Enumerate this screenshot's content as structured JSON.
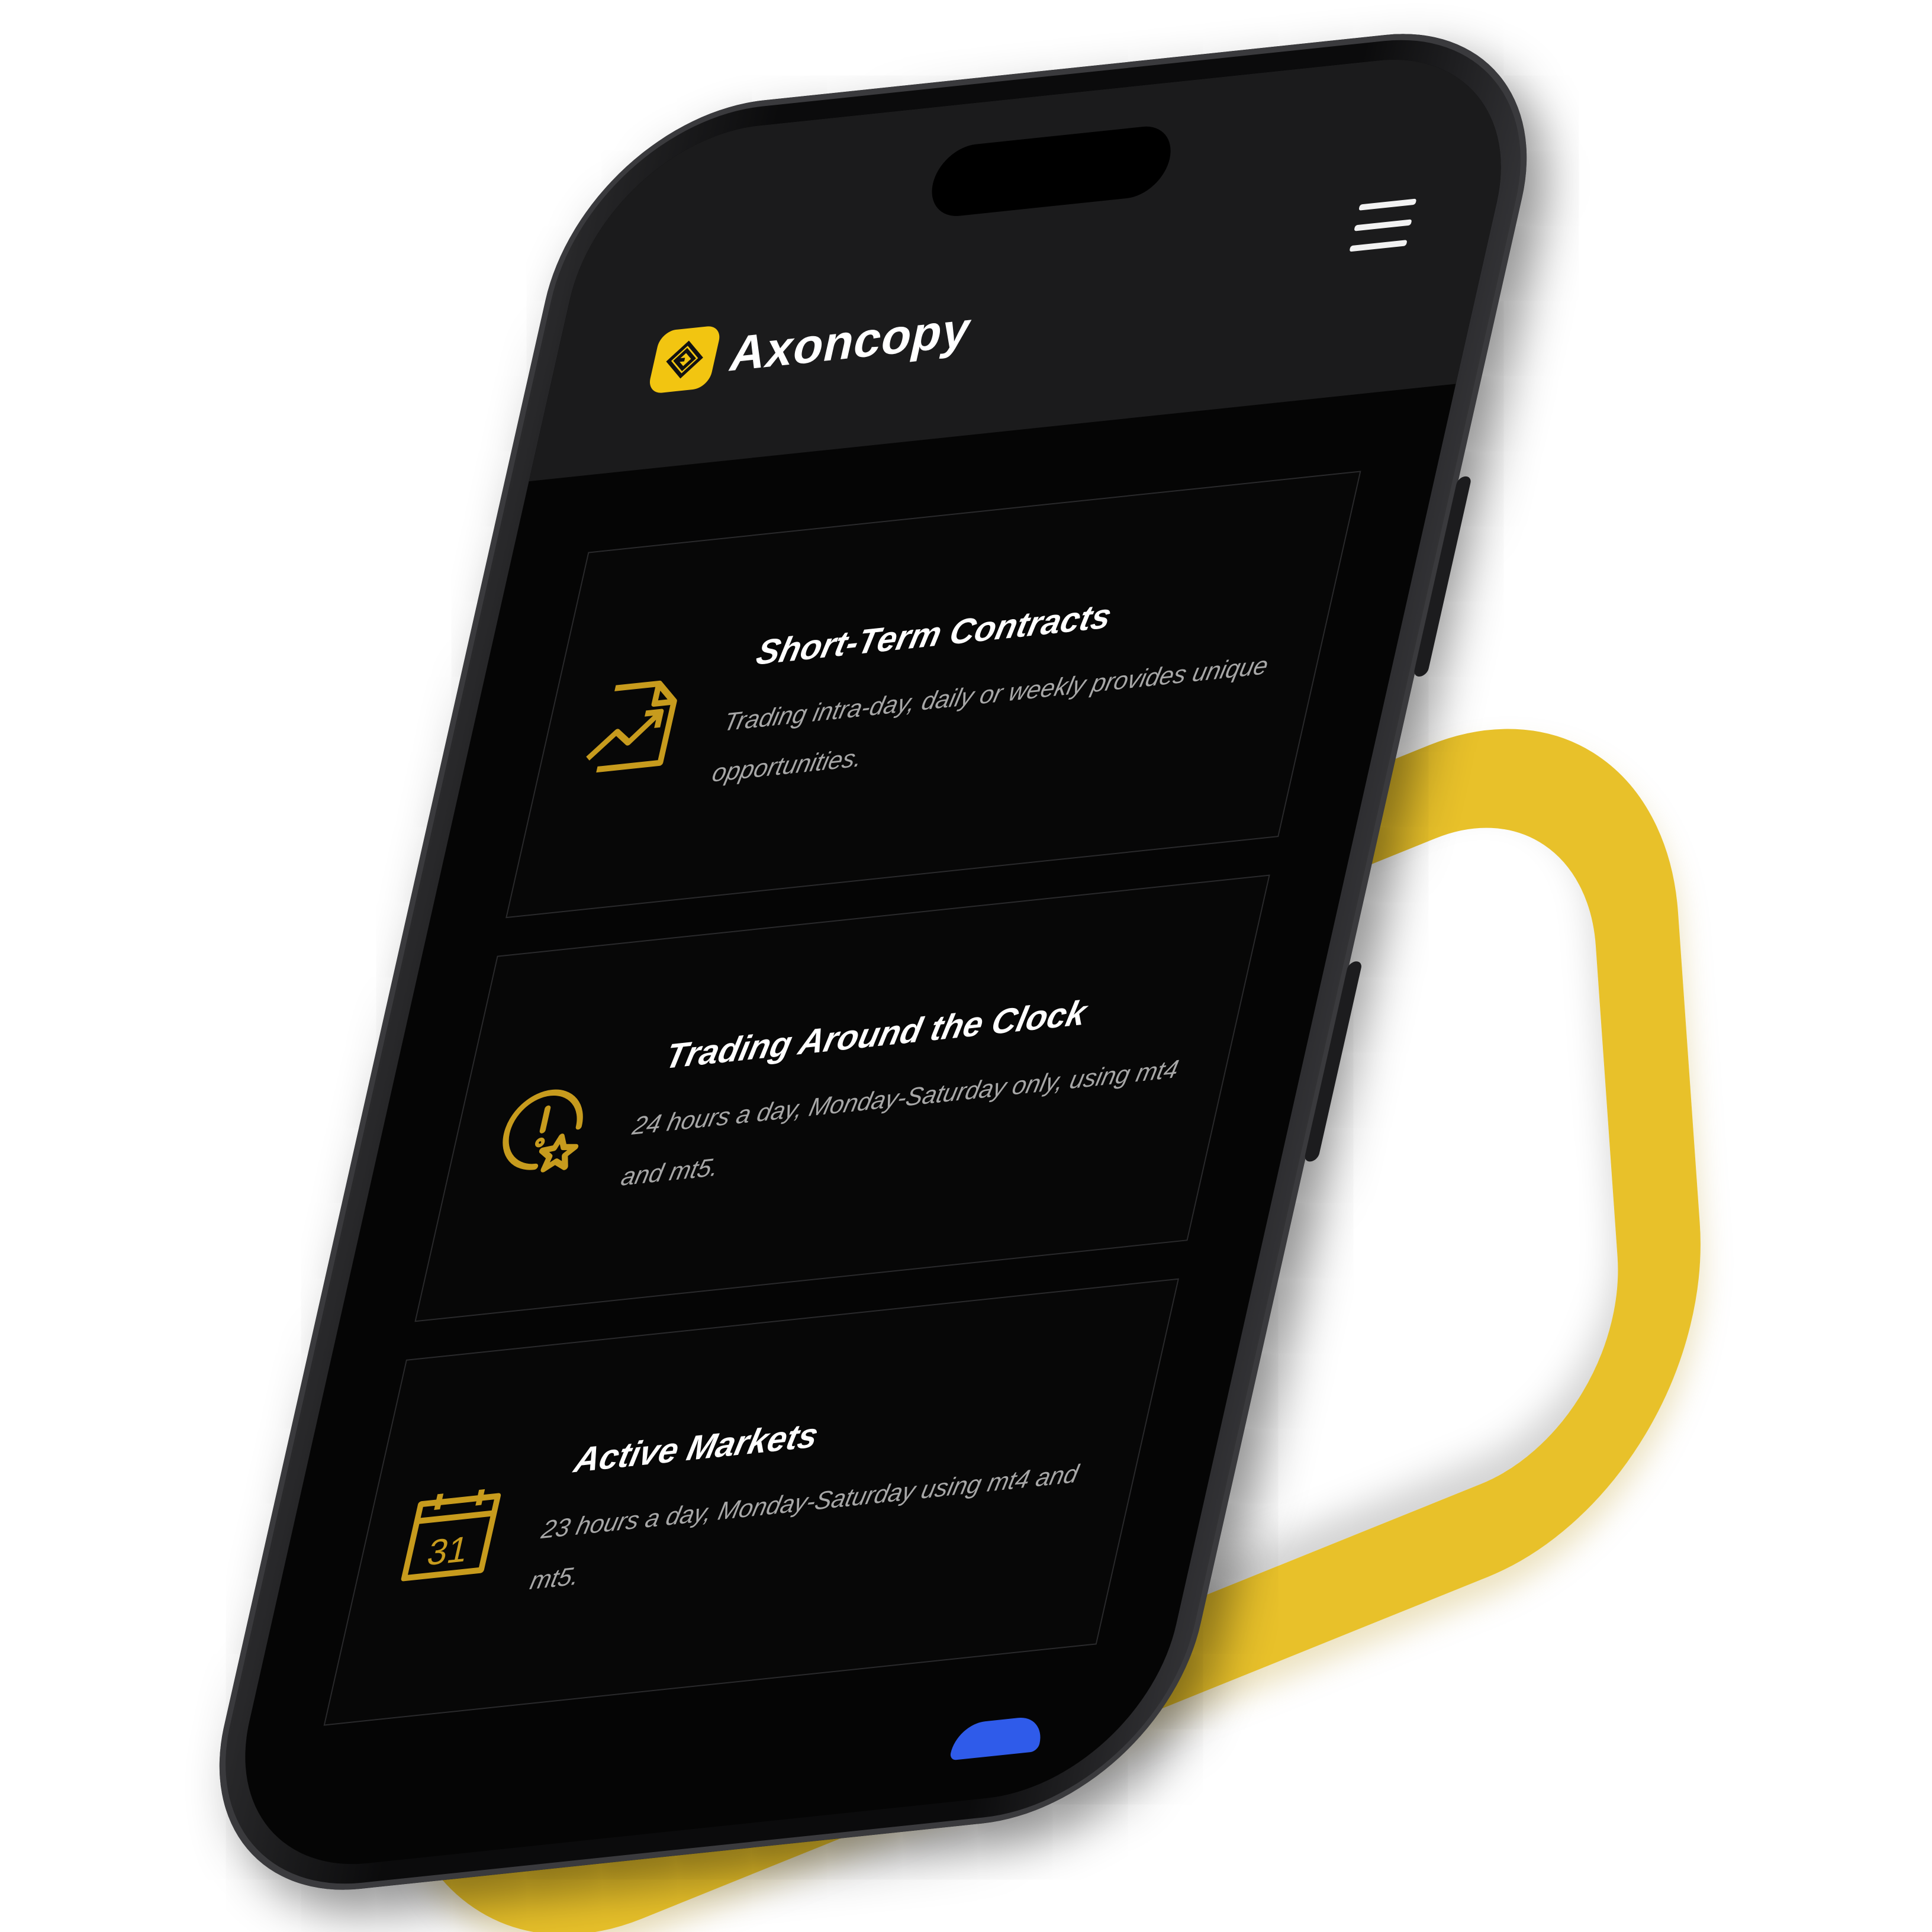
{
  "app": {
    "brand_name": "Axoncopy",
    "accent_color": "#f2c511",
    "background_color": "#050505"
  },
  "header": {
    "logo_icon": "axoncopy-logo-icon",
    "menu_icon": "hamburger-menu-icon"
  },
  "cards": [
    {
      "icon": "chart-document-icon",
      "title": "Short-Term Contracts",
      "text": "Trading intra-day, daily or weekly provides unique opportunities."
    },
    {
      "icon": "clock-star-icon",
      "title": "Trading Around the Clock",
      "text": "24 hours a day, Monday-Saturday only, using mt4 and mt5."
    },
    {
      "icon": "calendar-icon",
      "title": "Active Markets",
      "text": "23 hours a day, Monday-Saturday using mt4 and mt5.",
      "calendar_number": "31"
    }
  ]
}
